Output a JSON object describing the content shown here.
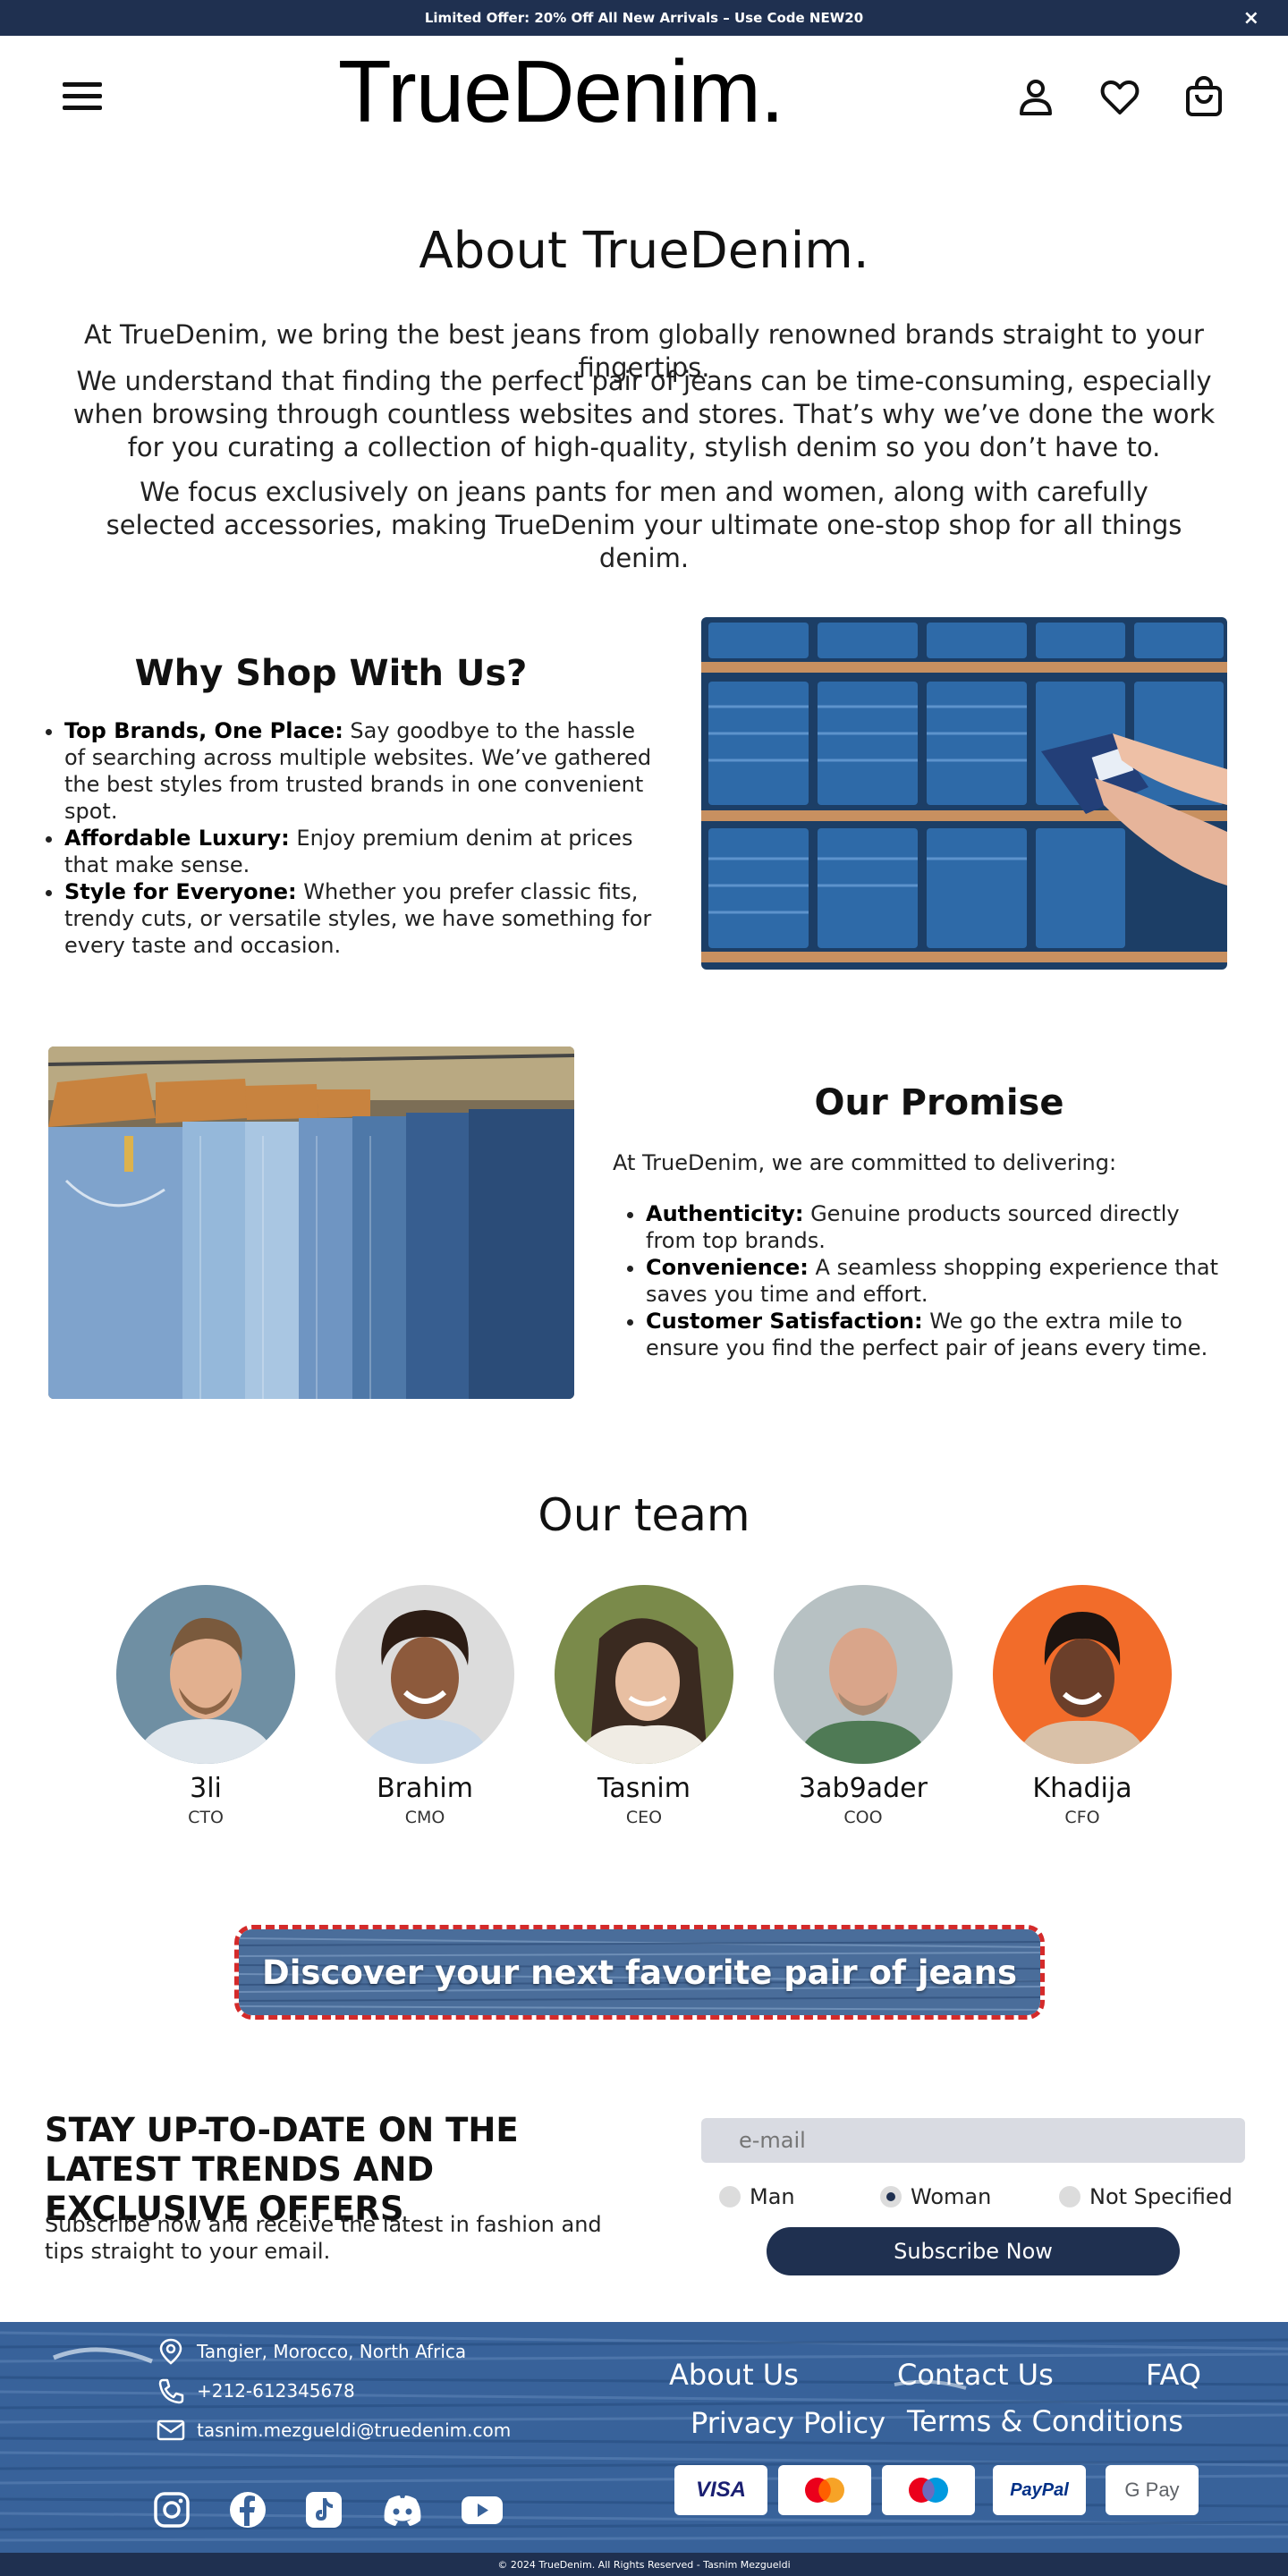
{
  "announcement": {
    "text": "Limited Offer: 20% Off All New Arrivals – Use Code NEW20",
    "close": "×"
  },
  "header": {
    "logo": "TrueDenim."
  },
  "about": {
    "title": "About TrueDenim.",
    "p1": "At TrueDenim, we bring the best jeans from globally renowned brands straight to your fingertips.",
    "p2": "We understand that finding the perfect pair of jeans can be time-consuming, especially when browsing through countless websites and stores. That’s why we’ve done the work for you curating a collection of high-quality, stylish denim so you don’t have to.",
    "p3": "We focus exclusively on jeans pants for men and women, along with carefully selected accessories, making TrueDenim your ultimate one-stop shop for all things denim."
  },
  "why": {
    "title": "Why Shop With Us?",
    "items": [
      {
        "title": "Top Brands, One Place:",
        "text": " Say goodbye to the hassle of searching across multiple websites. We’ve gathered the best styles from trusted brands in one convenient spot."
      },
      {
        "title": "Affordable Luxury:",
        "text": " Enjoy premium denim at prices that make sense."
      },
      {
        "title": "Style for Everyone:",
        "text": " Whether you prefer classic fits, trendy cuts, or versatile styles, we have something for every taste and occasion."
      }
    ]
  },
  "promise": {
    "title": "Our Promise",
    "intro": "At TrueDenim, we are committed to delivering:",
    "items": [
      {
        "title": "Authenticity:",
        "text": " Genuine products sourced directly from top brands."
      },
      {
        "title": "Convenience:",
        "text": " A seamless shopping experience that saves you time and effort."
      },
      {
        "title": "Customer Satisfaction:",
        "text": " We go the extra mile to ensure you find the perfect pair of jeans every time."
      }
    ]
  },
  "team": {
    "title": "Our team",
    "members": [
      {
        "name": "3li",
        "role": "CTO",
        "bg": "#6f8fa3"
      },
      {
        "name": "Brahim",
        "role": "CMO",
        "bg": "#dcdcdc"
      },
      {
        "name": "Tasnim",
        "role": "CEO",
        "bg": "#7a8a4a"
      },
      {
        "name": "3ab9ader",
        "role": "COO",
        "bg": "#b7c1c3"
      },
      {
        "name": "Khadija",
        "role": "CFO",
        "bg": "#f26c2a"
      }
    ]
  },
  "cta": {
    "label": "Discover your next favorite pair of jeans"
  },
  "newsletter": {
    "title": "STAY UP-TO-DATE ON THE LATEST TRENDS AND EXCLUSIVE OFFERS",
    "subtitle": "Subscribe now and receive the latest in fashion and tips straight to your email.",
    "email_placeholder": "e-mail",
    "options": [
      "Man",
      "Woman",
      "Not Specified"
    ],
    "selected": "Woman",
    "button": "Subscribe Now"
  },
  "footer": {
    "address": "Tangier, Morocco, North Africa",
    "phone": "+212-612345678",
    "email": "tasnim.mezgueldi@truedenim.com",
    "links": [
      "About Us",
      "Contact Us",
      "FAQ",
      "Privacy Policy",
      "Terms & Conditions"
    ],
    "payments": [
      "VISA",
      "PayPal",
      "G Pay"
    ],
    "copyright": "© 2024 TrueDenim. All Rights Reserved - Tasnim Mezgueldi"
  },
  "colors": {
    "navy": "#1f3050",
    "cta_border": "#d42a2a",
    "denim": "#1e4f86"
  }
}
